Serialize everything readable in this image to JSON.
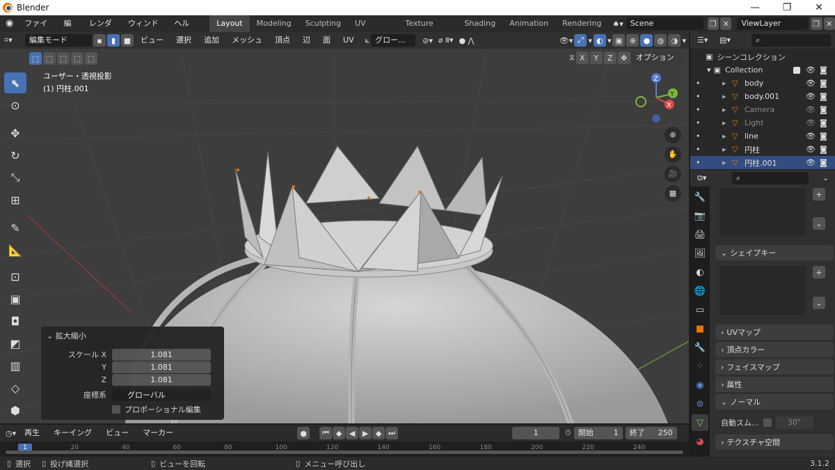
{
  "window": {
    "title": "Blender",
    "controls": [
      "—",
      "❐",
      "✕"
    ]
  },
  "menus": [
    "ファイル",
    "編集",
    "レンダー",
    "ウィンドウ",
    "ヘルプ"
  ],
  "workspaces": [
    "Layout",
    "Modeling",
    "Sculpting",
    "UV Editing",
    "Texture Paint",
    "Shading",
    "Animation",
    "Rendering"
  ],
  "scene": "Scene",
  "view_layer": "ViewLayer",
  "vp_header": {
    "mode": "編集モード",
    "view": "ビュー",
    "select": "選択",
    "add": "追加",
    "mesh": "メッシュ",
    "vertex": "頂点",
    "edge": "辺",
    "face": "面",
    "uv": "UV",
    "orientation": "グロー...",
    "options": "オプション",
    "x": "X",
    "y": "Y",
    "z": "Z"
  },
  "viewport": {
    "projection": "ユーザー・透視投影",
    "object": "(1) 円柱.001"
  },
  "operator": {
    "title": "拡大縮小",
    "scale_x_label": "スケール X",
    "y_label": "Y",
    "z_label": "Z",
    "x": "1.081",
    "y": "1.081",
    "z": "1.081",
    "orient_label": "座標系",
    "orient_value": "グローバル",
    "proportional": "プロポーショナル編集"
  },
  "timeline": {
    "playback": "再生",
    "keying": "キーイング",
    "view": "ビュー",
    "marker": "マーカー",
    "current": "1",
    "start_label": "開始",
    "start": "1",
    "end_label": "終了",
    "end": "250",
    "ticks": [
      "1",
      "20",
      "40",
      "60",
      "80",
      "100",
      "120",
      "140",
      "160",
      "180",
      "200",
      "220",
      "240"
    ]
  },
  "status": {
    "select": "選択",
    "box": "投げ縄選択",
    "rotate": "ビューを回転",
    "menu": "メニュー呼び出し",
    "version": "3.1.2"
  },
  "outliner": {
    "scene_collection": "シーンコレクション",
    "collection": "Collection",
    "items": [
      {
        "name": "body",
        "enabled": true
      },
      {
        "name": "body.001",
        "enabled": true
      },
      {
        "name": "Camera",
        "enabled": false
      },
      {
        "name": "Light",
        "enabled": false
      },
      {
        "name": "line",
        "enabled": true
      },
      {
        "name": "円柱",
        "enabled": true
      },
      {
        "name": "円柱.001",
        "enabled": true,
        "selected": true
      }
    ]
  },
  "properties": {
    "shape_keys": "シェイプキー",
    "panels": [
      "UVマップ",
      "頂点カラー",
      "フェイスマップ",
      "属性",
      "ノーマル"
    ],
    "auto_smooth": "自動スム...",
    "angle": "30°",
    "texture_space": "テクスチャ空間"
  },
  "colors": {
    "accent": "#4772b3",
    "orange": "#ea7600",
    "bg": "#3d3d3d"
  }
}
